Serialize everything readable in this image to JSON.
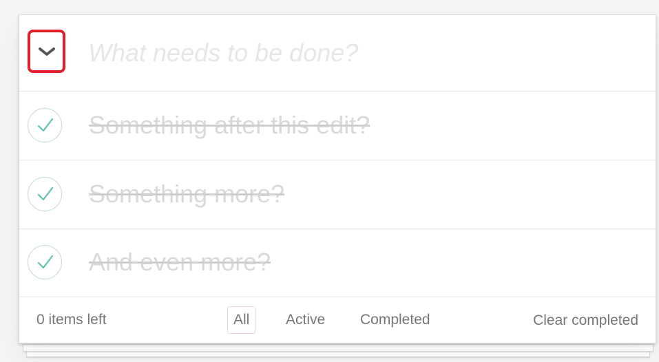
{
  "new_todo": {
    "placeholder": "What needs to be done?",
    "value": ""
  },
  "toggle_all": {
    "icon": "chevron-down-icon"
  },
  "todos": [
    {
      "label": "Something after this edit?",
      "completed": true
    },
    {
      "label": "Something more?",
      "completed": true
    },
    {
      "label": "And even more?",
      "completed": true
    }
  ],
  "footer": {
    "items_left": "0 items left",
    "filters": [
      "All",
      "Active",
      "Completed"
    ],
    "selected_filter": "All",
    "clear_completed": "Clear completed"
  },
  "colors": {
    "highlight_border": "#e0202a",
    "check_mark": "#5dc2af",
    "completed_text": "#d9d9d9",
    "footer_text": "#777777"
  }
}
